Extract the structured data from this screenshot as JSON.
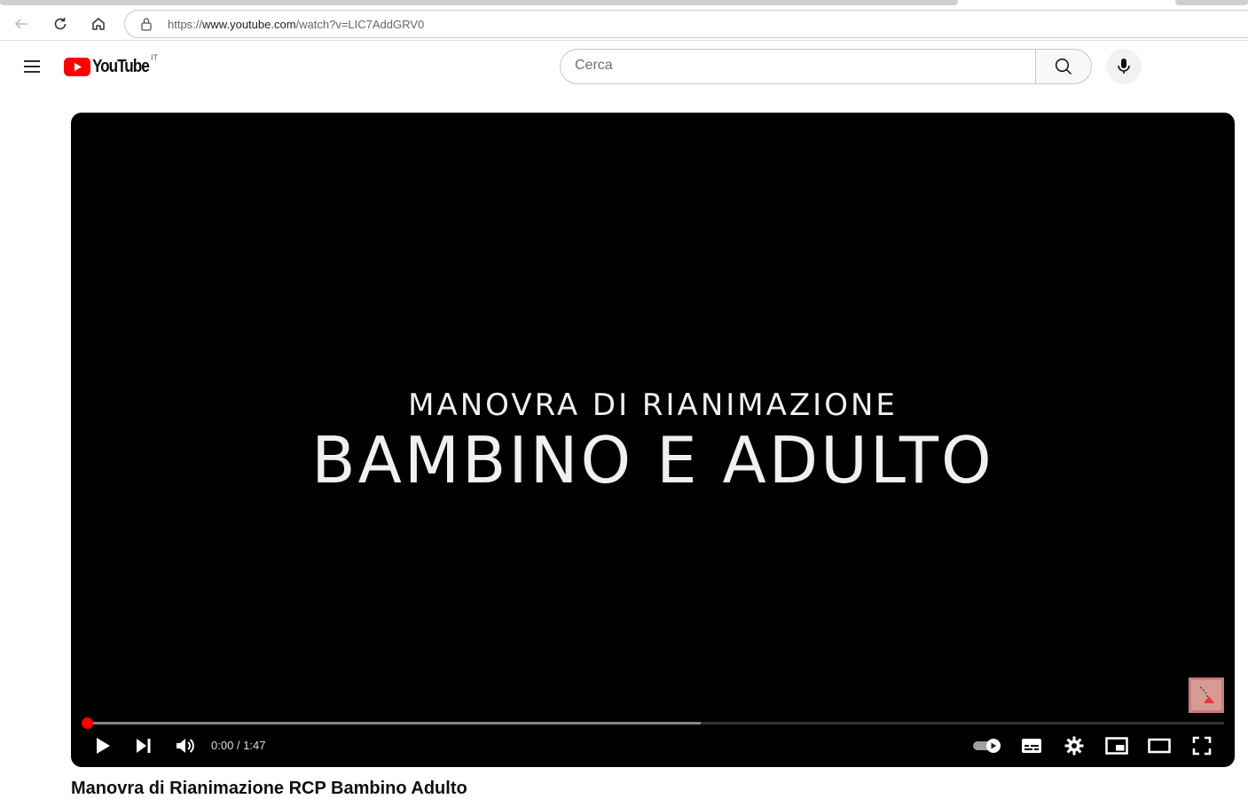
{
  "browser": {
    "url_prefix": "https://",
    "url_host": "www.youtube.com",
    "url_path": "/watch?v=LIC7AddGRV0"
  },
  "header": {
    "logo_text": "YouTube",
    "country_code": "IT",
    "search_placeholder": "Cerca"
  },
  "player": {
    "title_line1": "MANOVRA DI RIANIMAZIONE",
    "title_line2": "BAMBINO E ADULTO",
    "time_display": "0:00 / 1:47",
    "progress_fraction": 0,
    "buffered_fraction": 0.54,
    "colors": {
      "progress": "#ff0000",
      "background": "#000000"
    }
  },
  "below": {
    "video_title_partial": "Manovra di Rianimazione RCP Bambino Adulto"
  }
}
